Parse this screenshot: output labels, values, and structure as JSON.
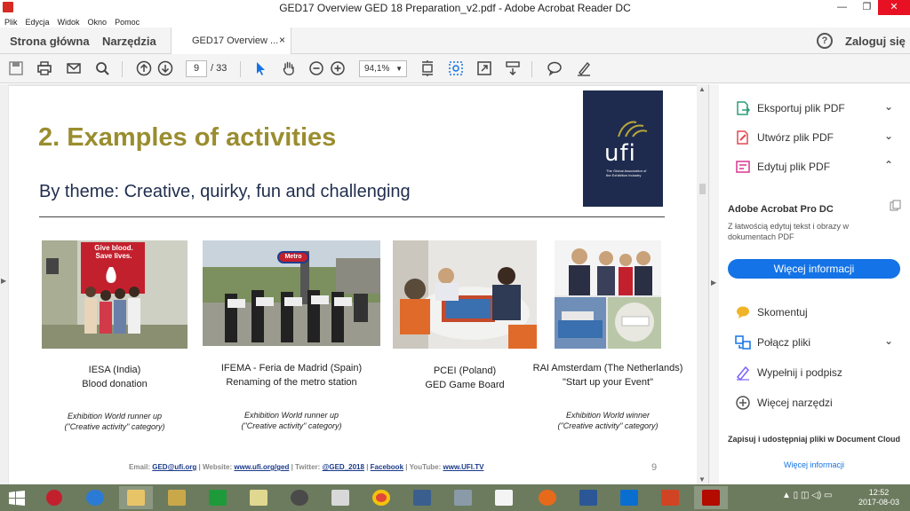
{
  "window": {
    "title": "GED17 Overview  GED 18 Preparation_v2.pdf - Adobe Acrobat Reader DC",
    "controls": {
      "minimize": "—",
      "maximize": "❐",
      "close": "✕"
    }
  },
  "menu": [
    "Plik",
    "Edycja",
    "Widok",
    "Okno",
    "Pomoc"
  ],
  "tabs": {
    "home": "Strona główna",
    "tools": "Narzędzia",
    "document": "GED17 Overview ...",
    "close_glyph": "×",
    "help_glyph": "?",
    "sign_in": "Zaloguj się"
  },
  "toolbar": {
    "current_page": "9",
    "total_pages": "/ 33",
    "zoom": "94,1%",
    "zoom_caret": "▼"
  },
  "slide": {
    "title": "2. Examples of activities",
    "subtitle": "By theme: Creative, quirky, fun and challenging",
    "logo_text": "ufi",
    "logo_tagline": "The Global Association of the Exhibition Industry",
    "items": [
      {
        "org": "IESA (India)",
        "activity": "Blood donation",
        "award_line1": "Exhibition World runner up",
        "award_line2": "(\"Creative activity\" category)",
        "photo_text": "Give blood. Save lives."
      },
      {
        "org": "IFEMA - Feria de Madrid (Spain)",
        "activity": "Renaming of the metro station",
        "award_line1": "Exhibition World runner up",
        "award_line2": "(\"Creative activity\" category)",
        "photo_text": "Metro"
      },
      {
        "org": "PCEI (Poland)",
        "activity": "GED Game Board",
        "award_line1": "",
        "award_line2": "",
        "photo_text": ""
      },
      {
        "org": "RAI Amsterdam (The Netherlands)",
        "activity": "\"Start up your Event\"",
        "award_line1": "Exhibition World winner",
        "award_line2": "(\"Creative activity\" category)",
        "photo_text": ""
      }
    ],
    "footer": {
      "email_label": "Email:",
      "email": "GED@ufi.org",
      "website_label": "| Website:",
      "website": "www.ufi.org/ged",
      "twitter_label": "| Twitter:",
      "twitter": "@GED_2018",
      "sep": "|",
      "facebook": "Facebook",
      "youtube_label": "| YouTube:",
      "youtube": "www.UFI.TV"
    },
    "page_number": "9"
  },
  "panel": {
    "tools": [
      {
        "label": "Eksportuj plik PDF",
        "chevron": "⌄",
        "color": "#2d9d78"
      },
      {
        "label": "Utwórz plik PDF",
        "chevron": "⌄",
        "color": "#e34850"
      },
      {
        "label": "Edytuj plik PDF",
        "chevron": "⌃",
        "color": "#d83790"
      }
    ],
    "promo_title": "Adobe Acrobat Pro DC",
    "promo_desc": "Z łatwością edytuj tekst i obrazy w dokumentach PDF",
    "promo_button": "Więcej informacji",
    "more_tools": [
      {
        "label": "Skomentuj",
        "chevron": "",
        "color": "#f0b428"
      },
      {
        "label": "Połącz pliki",
        "chevron": "⌄",
        "color": "#1473e6"
      },
      {
        "label": "Wypełnij i podpisz",
        "chevron": "",
        "color": "#7b61ff"
      },
      {
        "label": "Więcej narzędzi",
        "chevron": "",
        "color": "#555555"
      }
    ],
    "footer_text": "Zapisuj i udostępniaj pliki w Document Cloud",
    "footer_link": "Więcej informacji"
  },
  "taskbar": {
    "time": "12:52",
    "date": "2017-08-03",
    "tray_glyphs": "▲ ▯ ◫ ◁) ▭"
  }
}
